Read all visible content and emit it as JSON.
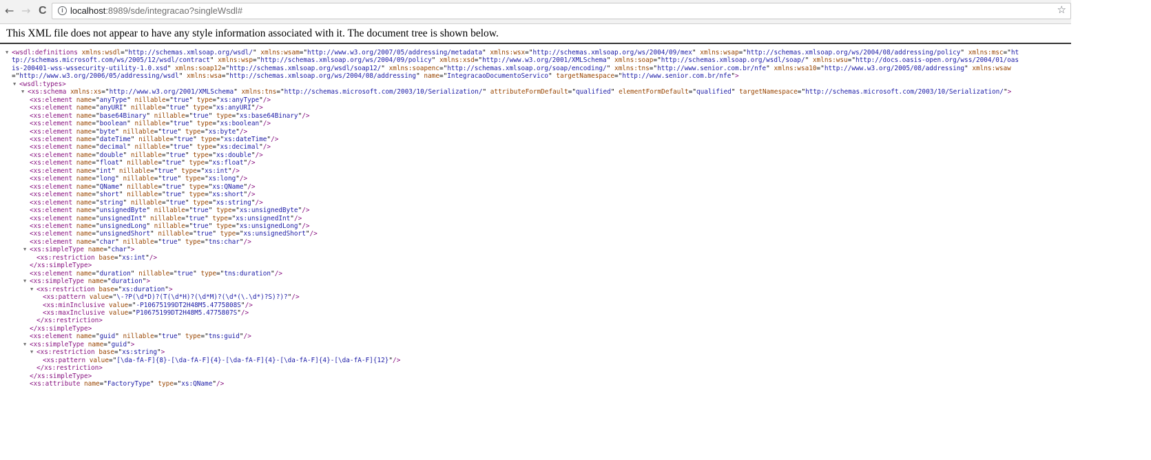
{
  "browser": {
    "back_icon": "←",
    "forward_icon": "→",
    "reload_icon": "C",
    "info_icon": "i",
    "url_host": "localhost",
    "url_rest": ":8989/sde/integracao?singleWsdl#",
    "star_icon": "☆"
  },
  "notice": "This XML file does not appear to have any style information associated with it. The document tree is shown below.",
  "colors": {
    "tag": "#881280",
    "attr_name": "#994500",
    "attr_value": "#1a1aa6"
  },
  "xml_lines": [
    {
      "level": 0,
      "arrow": true,
      "kind": "open",
      "tag": "wsdl:definitions",
      "attrs": [
        [
          "xmlns:wsdl",
          "http://schemas.xmlsoap.org/wsdl/"
        ],
        [
          "xmlns:wsam",
          "http://www.w3.org/2007/05/addressing/metadata"
        ],
        [
          "xmlns:wsx",
          "http://schemas.xmlsoap.org/ws/2004/09/mex"
        ],
        [
          "xmlns:wsap",
          "http://schemas.xmlsoap.org/ws/2004/08/addressing/policy"
        ],
        [
          "xmlns:msc",
          "http://schemas.microsoft.com/ws/2005/12/wsdl/contract"
        ],
        [
          "xmlns:wsp",
          "http://schemas.xmlsoap.org/ws/2004/09/policy"
        ],
        [
          "xmlns:xsd",
          "http://www.w3.org/2001/XMLSchema"
        ],
        [
          "xmlns:soap",
          "http://schemas.xmlsoap.org/wsdl/soap/"
        ],
        [
          "xmlns:wsu",
          "http://docs.oasis-open.org/wss/2004/01/oasis-200401-wss-wssecurity-utility-1.0.xsd"
        ],
        [
          "xmlns:soap12",
          "http://schemas.xmlsoap.org/wsdl/soap12/"
        ],
        [
          "xmlns:soapenc",
          "http://schemas.xmlsoap.org/soap/encoding/"
        ],
        [
          "xmlns:tns",
          "http://www.senior.com.br/nfe"
        ],
        [
          "xmlns:wsa10",
          "http://www.w3.org/2005/08/addressing"
        ],
        [
          "xmlns:wsaw",
          "http://www.w3.org/2006/05/addressing/wsdl"
        ],
        [
          "xmlns:wsa",
          "http://schemas.xmlsoap.org/ws/2004/08/addressing"
        ],
        [
          "name",
          "IntegracaoDocumentoServico"
        ],
        [
          "targetNamespace",
          "http://www.senior.com.br/nfe"
        ]
      ]
    },
    {
      "level": 1,
      "arrow": true,
      "kind": "open",
      "tag": "wsdl:types",
      "attrs": []
    },
    {
      "level": 2,
      "arrow": true,
      "kind": "open",
      "tag": "xs:schema",
      "attrs": [
        [
          "xmlns:xs",
          "http://www.w3.org/2001/XMLSchema"
        ],
        [
          "xmlns:tns",
          "http://schemas.microsoft.com/2003/10/Serialization/"
        ],
        [
          "attributeFormDefault",
          "qualified"
        ],
        [
          "elementFormDefault",
          "qualified"
        ],
        [
          "targetNamespace",
          "http://schemas.microsoft.com/2003/10/Serialization/"
        ]
      ]
    },
    {
      "level": 3,
      "kind": "self",
      "tag": "xs:element",
      "attrs": [
        [
          "name",
          "anyType"
        ],
        [
          "nillable",
          "true"
        ],
        [
          "type",
          "xs:anyType"
        ]
      ]
    },
    {
      "level": 3,
      "kind": "self",
      "tag": "xs:element",
      "attrs": [
        [
          "name",
          "anyURI"
        ],
        [
          "nillable",
          "true"
        ],
        [
          "type",
          "xs:anyURI"
        ]
      ]
    },
    {
      "level": 3,
      "kind": "self",
      "tag": "xs:element",
      "attrs": [
        [
          "name",
          "base64Binary"
        ],
        [
          "nillable",
          "true"
        ],
        [
          "type",
          "xs:base64Binary"
        ]
      ]
    },
    {
      "level": 3,
      "kind": "self",
      "tag": "xs:element",
      "attrs": [
        [
          "name",
          "boolean"
        ],
        [
          "nillable",
          "true"
        ],
        [
          "type",
          "xs:boolean"
        ]
      ]
    },
    {
      "level": 3,
      "kind": "self",
      "tag": "xs:element",
      "attrs": [
        [
          "name",
          "byte"
        ],
        [
          "nillable",
          "true"
        ],
        [
          "type",
          "xs:byte"
        ]
      ]
    },
    {
      "level": 3,
      "kind": "self",
      "tag": "xs:element",
      "attrs": [
        [
          "name",
          "dateTime"
        ],
        [
          "nillable",
          "true"
        ],
        [
          "type",
          "xs:dateTime"
        ]
      ]
    },
    {
      "level": 3,
      "kind": "self",
      "tag": "xs:element",
      "attrs": [
        [
          "name",
          "decimal"
        ],
        [
          "nillable",
          "true"
        ],
        [
          "type",
          "xs:decimal"
        ]
      ]
    },
    {
      "level": 3,
      "kind": "self",
      "tag": "xs:element",
      "attrs": [
        [
          "name",
          "double"
        ],
        [
          "nillable",
          "true"
        ],
        [
          "type",
          "xs:double"
        ]
      ]
    },
    {
      "level": 3,
      "kind": "self",
      "tag": "xs:element",
      "attrs": [
        [
          "name",
          "float"
        ],
        [
          "nillable",
          "true"
        ],
        [
          "type",
          "xs:float"
        ]
      ]
    },
    {
      "level": 3,
      "kind": "self",
      "tag": "xs:element",
      "attrs": [
        [
          "name",
          "int"
        ],
        [
          "nillable",
          "true"
        ],
        [
          "type",
          "xs:int"
        ]
      ]
    },
    {
      "level": 3,
      "kind": "self",
      "tag": "xs:element",
      "attrs": [
        [
          "name",
          "long"
        ],
        [
          "nillable",
          "true"
        ],
        [
          "type",
          "xs:long"
        ]
      ]
    },
    {
      "level": 3,
      "kind": "self",
      "tag": "xs:element",
      "attrs": [
        [
          "name",
          "QName"
        ],
        [
          "nillable",
          "true"
        ],
        [
          "type",
          "xs:QName"
        ]
      ]
    },
    {
      "level": 3,
      "kind": "self",
      "tag": "xs:element",
      "attrs": [
        [
          "name",
          "short"
        ],
        [
          "nillable",
          "true"
        ],
        [
          "type",
          "xs:short"
        ]
      ]
    },
    {
      "level": 3,
      "kind": "self",
      "tag": "xs:element",
      "attrs": [
        [
          "name",
          "string"
        ],
        [
          "nillable",
          "true"
        ],
        [
          "type",
          "xs:string"
        ]
      ]
    },
    {
      "level": 3,
      "kind": "self",
      "tag": "xs:element",
      "attrs": [
        [
          "name",
          "unsignedByte"
        ],
        [
          "nillable",
          "true"
        ],
        [
          "type",
          "xs:unsignedByte"
        ]
      ]
    },
    {
      "level": 3,
      "kind": "self",
      "tag": "xs:element",
      "attrs": [
        [
          "name",
          "unsignedInt"
        ],
        [
          "nillable",
          "true"
        ],
        [
          "type",
          "xs:unsignedInt"
        ]
      ]
    },
    {
      "level": 3,
      "kind": "self",
      "tag": "xs:element",
      "attrs": [
        [
          "name",
          "unsignedLong"
        ],
        [
          "nillable",
          "true"
        ],
        [
          "type",
          "xs:unsignedLong"
        ]
      ]
    },
    {
      "level": 3,
      "kind": "self",
      "tag": "xs:element",
      "attrs": [
        [
          "name",
          "unsignedShort"
        ],
        [
          "nillable",
          "true"
        ],
        [
          "type",
          "xs:unsignedShort"
        ]
      ]
    },
    {
      "level": 3,
      "kind": "self",
      "tag": "xs:element",
      "attrs": [
        [
          "name",
          "char"
        ],
        [
          "nillable",
          "true"
        ],
        [
          "type",
          "tns:char"
        ]
      ]
    },
    {
      "level": 3,
      "arrow": true,
      "kind": "open",
      "tag": "xs:simpleType",
      "attrs": [
        [
          "name",
          "char"
        ]
      ]
    },
    {
      "level": 4,
      "kind": "self",
      "tag": "xs:restriction",
      "attrs": [
        [
          "base",
          "xs:int"
        ]
      ]
    },
    {
      "level": 3,
      "kind": "close",
      "tag": "xs:simpleType",
      "attrs": []
    },
    {
      "level": 3,
      "kind": "self",
      "tag": "xs:element",
      "attrs": [
        [
          "name",
          "duration"
        ],
        [
          "nillable",
          "true"
        ],
        [
          "type",
          "tns:duration"
        ]
      ]
    },
    {
      "level": 3,
      "arrow": true,
      "kind": "open",
      "tag": "xs:simpleType",
      "attrs": [
        [
          "name",
          "duration"
        ]
      ]
    },
    {
      "level": 4,
      "arrow": true,
      "kind": "open",
      "tag": "xs:restriction",
      "attrs": [
        [
          "base",
          "xs:duration"
        ]
      ]
    },
    {
      "level": 5,
      "kind": "self",
      "tag": "xs:pattern",
      "attrs": [
        [
          "value",
          "\\-?P(\\d*D)?(T(\\d*H)?(\\d*M)?(\\d*(\\.\\d*)?S)?)?"
        ]
      ]
    },
    {
      "level": 5,
      "kind": "self",
      "tag": "xs:minInclusive",
      "attrs": [
        [
          "value",
          "-P10675199DT2H48M5.4775808S"
        ]
      ]
    },
    {
      "level": 5,
      "kind": "self",
      "tag": "xs:maxInclusive",
      "attrs": [
        [
          "value",
          "P10675199DT2H48M5.4775807S"
        ]
      ]
    },
    {
      "level": 4,
      "kind": "close",
      "tag": "xs:restriction",
      "attrs": []
    },
    {
      "level": 3,
      "kind": "close",
      "tag": "xs:simpleType",
      "attrs": []
    },
    {
      "level": 3,
      "kind": "self",
      "tag": "xs:element",
      "attrs": [
        [
          "name",
          "guid"
        ],
        [
          "nillable",
          "true"
        ],
        [
          "type",
          "tns:guid"
        ]
      ]
    },
    {
      "level": 3,
      "arrow": true,
      "kind": "open",
      "tag": "xs:simpleType",
      "attrs": [
        [
          "name",
          "guid"
        ]
      ]
    },
    {
      "level": 4,
      "arrow": true,
      "kind": "open",
      "tag": "xs:restriction",
      "attrs": [
        [
          "base",
          "xs:string"
        ]
      ]
    },
    {
      "level": 5,
      "kind": "self",
      "tag": "xs:pattern",
      "attrs": [
        [
          "value",
          "[\\da-fA-F]{8}-[\\da-fA-F]{4}-[\\da-fA-F]{4}-[\\da-fA-F]{4}-[\\da-fA-F]{12}"
        ]
      ]
    },
    {
      "level": 4,
      "kind": "close",
      "tag": "xs:restriction",
      "attrs": []
    },
    {
      "level": 3,
      "kind": "close",
      "tag": "xs:simpleType",
      "attrs": []
    },
    {
      "level": 3,
      "kind": "self",
      "tag": "xs:attribute",
      "attrs": [
        [
          "name",
          "FactoryType"
        ],
        [
          "type",
          "xs:QName"
        ]
      ]
    }
  ]
}
